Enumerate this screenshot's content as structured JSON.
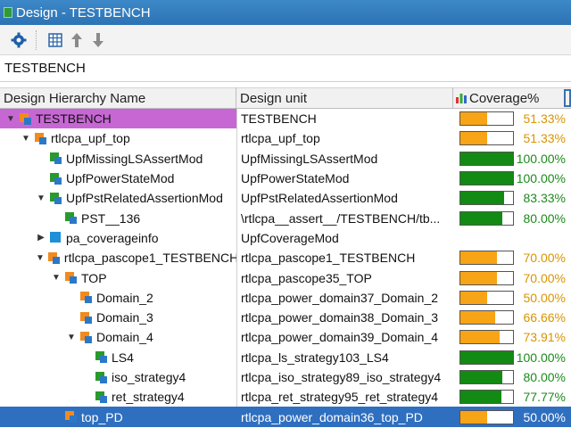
{
  "window": {
    "title": "Design - TESTBENCH"
  },
  "toolbar": {
    "icons": [
      "gear-icon",
      "grid-icon",
      "arrow-up-icon",
      "arrow-down-icon"
    ]
  },
  "filter": {
    "value": "TESTBENCH"
  },
  "columns": {
    "name": "Design Hierarchy Name",
    "unit": "Design unit",
    "coverage": "Coverage%"
  },
  "colors": {
    "orange": "#f7a416",
    "green": "#138a13",
    "selected": "#2f6fbf",
    "highlight": "#c767d4"
  },
  "rows": [
    {
      "name": "TESTBENCH",
      "unit": "TESTBENCH",
      "pct": "51.33%",
      "fill": 0.5133,
      "color": "orange",
      "twisty": "down",
      "highlight": true
    },
    {
      "name": "rtlcpa_upf_top",
      "unit": "rtlcpa_upf_top",
      "pct": "51.33%",
      "fill": 0.5133,
      "color": "orange",
      "twisty": "down"
    },
    {
      "name": "UpfMissingLSAssertMod",
      "unit": "UpfMissingLSAssertMod",
      "pct": "100.00%",
      "fill": 1.0,
      "color": "green",
      "twisty": "none"
    },
    {
      "name": "UpfPowerStateMod",
      "unit": "UpfPowerStateMod",
      "pct": "100.00%",
      "fill": 1.0,
      "color": "green",
      "twisty": "none"
    },
    {
      "name": "UpfPstRelatedAssertionMod",
      "unit": "UpfPstRelatedAssertionMod",
      "pct": "83.33%",
      "fill": 0.8333,
      "color": "green",
      "twisty": "down"
    },
    {
      "name": "PST__136",
      "unit": "\\rtlcpa__assert__/TESTBENCH/tb...",
      "pct": "80.00%",
      "fill": 0.8,
      "color": "green",
      "twisty": "none"
    },
    {
      "name": "pa_coverageinfo",
      "unit": "UpfCoverageMod",
      "pct": "",
      "fill": null,
      "color": "",
      "twisty": "right"
    },
    {
      "name": "rtlcpa_pascope1_TESTBENCH",
      "unit": "rtlcpa_pascope1_TESTBENCH",
      "pct": "70.00%",
      "fill": 0.7,
      "color": "orange",
      "twisty": "down"
    },
    {
      "name": "TOP",
      "unit": "rtlcpa_pascope35_TOP",
      "pct": "70.00%",
      "fill": 0.7,
      "color": "orange",
      "twisty": "down"
    },
    {
      "name": "Domain_2",
      "unit": "rtlcpa_power_domain37_Domain_2",
      "pct": "50.00%",
      "fill": 0.5,
      "color": "orange",
      "twisty": "none"
    },
    {
      "name": "Domain_3",
      "unit": "rtlcpa_power_domain38_Domain_3",
      "pct": "66.66%",
      "fill": 0.6666,
      "color": "orange",
      "twisty": "none"
    },
    {
      "name": "Domain_4",
      "unit": "rtlcpa_power_domain39_Domain_4",
      "pct": "73.91%",
      "fill": 0.7391,
      "color": "orange",
      "twisty": "down"
    },
    {
      "name": "LS4",
      "unit": "rtlcpa_ls_strategy103_LS4",
      "pct": "100.00%",
      "fill": 1.0,
      "color": "green",
      "twisty": "none"
    },
    {
      "name": "iso_strategy4",
      "unit": "rtlcpa_iso_strategy89_iso_strategy4",
      "pct": "80.00%",
      "fill": 0.8,
      "color": "green",
      "twisty": "none"
    },
    {
      "name": "ret_strategy4",
      "unit": "rtlcpa_ret_strategy95_ret_strategy4",
      "pct": "77.77%",
      "fill": 0.7777,
      "color": "green",
      "twisty": "none"
    },
    {
      "name": "top_PD",
      "unit": "rtlcpa_power_domain36_top_PD",
      "pct": "50.00%",
      "fill": 0.5,
      "color": "orange",
      "twisty": "none",
      "selected": true
    }
  ]
}
